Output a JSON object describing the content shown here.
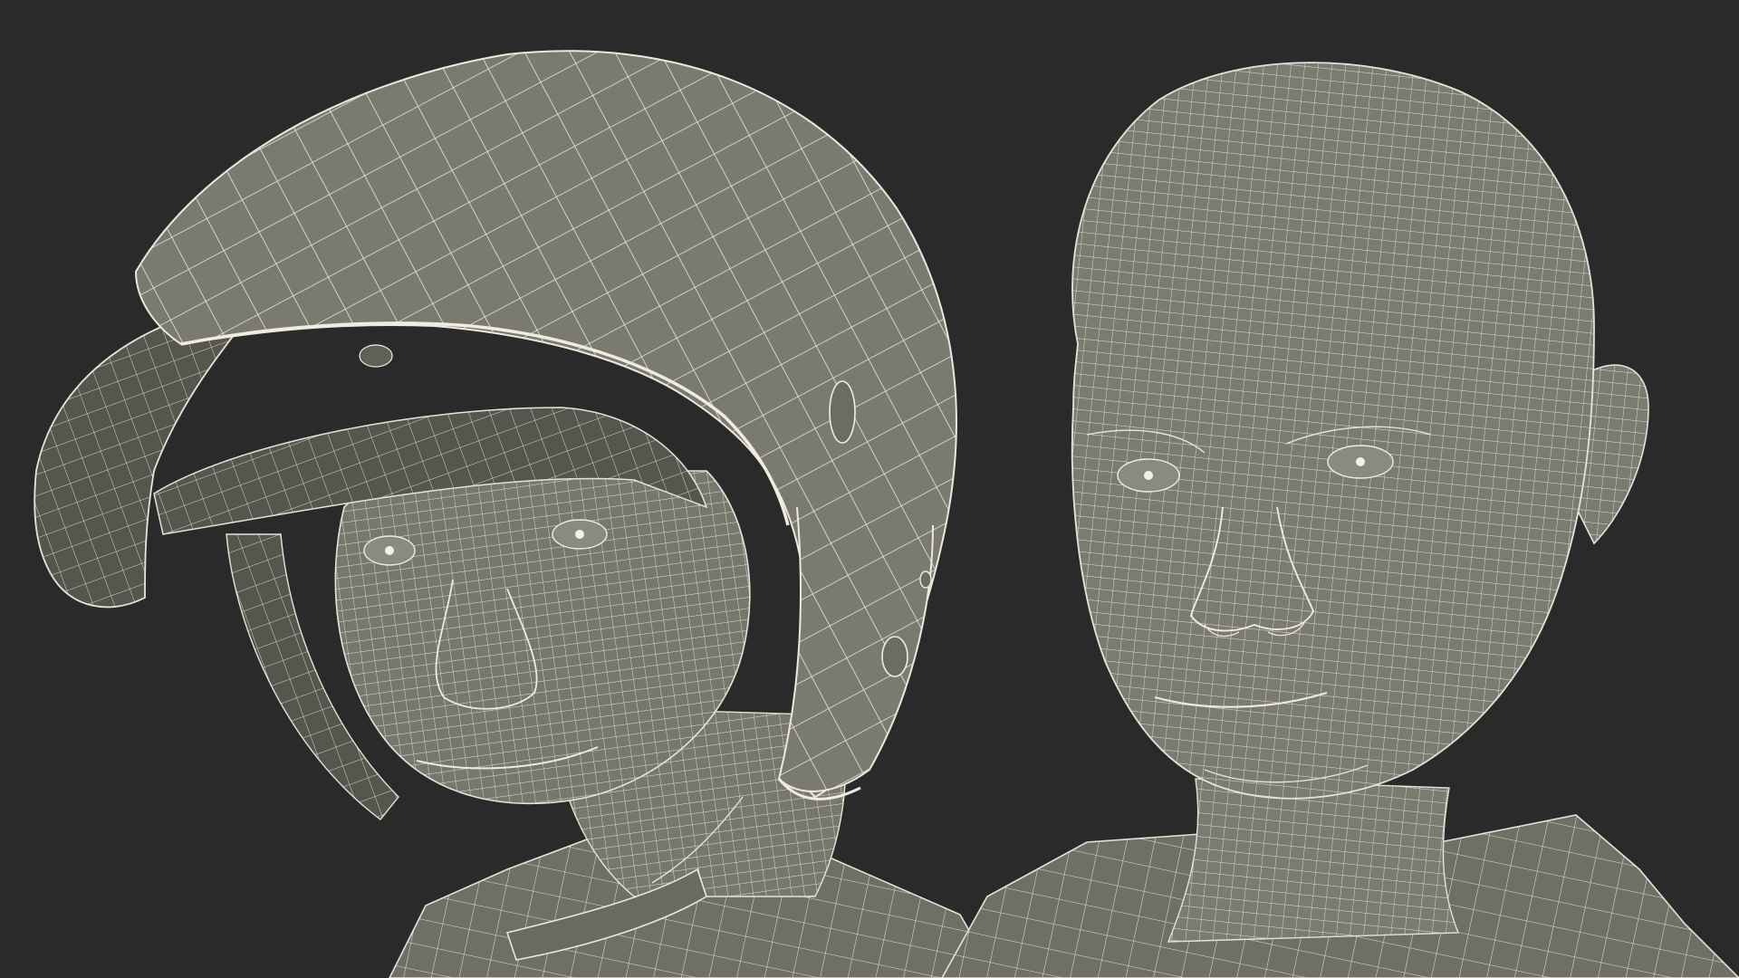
{
  "scene": {
    "background_color": "#2a2a2a",
    "mesh_color": "#7a7a70",
    "wire_color": "#e8e5d8"
  },
  "models": [
    {
      "name": "head-with-helmet"
    },
    {
      "name": "bare-head"
    }
  ]
}
